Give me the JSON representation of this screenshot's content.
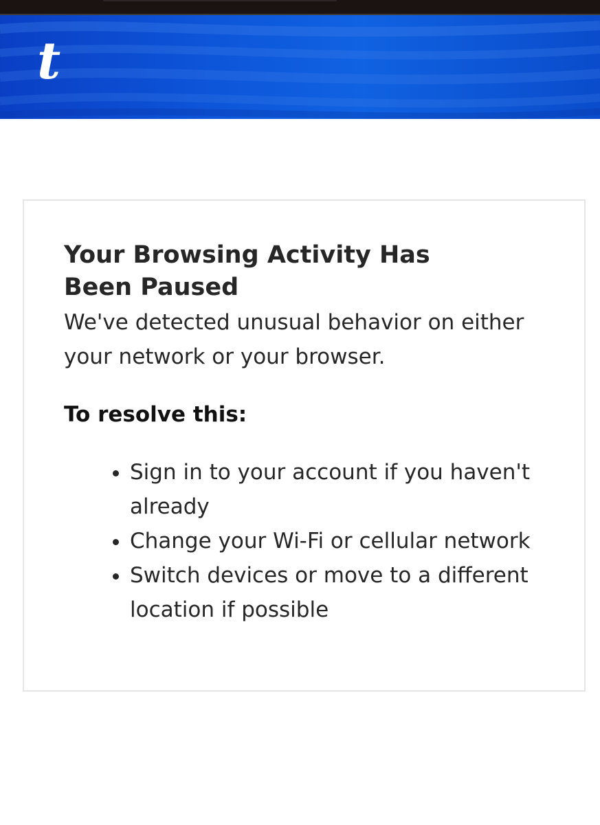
{
  "header": {
    "logo_text": "t",
    "brand_color": "#0d55d9"
  },
  "card": {
    "title": "Your Browsing Activity Has Been Paused",
    "description": "We've detected unusual behavior on either your network or your browser.",
    "resolve_heading": "To resolve this:",
    "steps": [
      "Sign in to your account if you haven't already",
      "Change your Wi-Fi or cellular network",
      "Switch devices or move to a different location if possible"
    ]
  }
}
